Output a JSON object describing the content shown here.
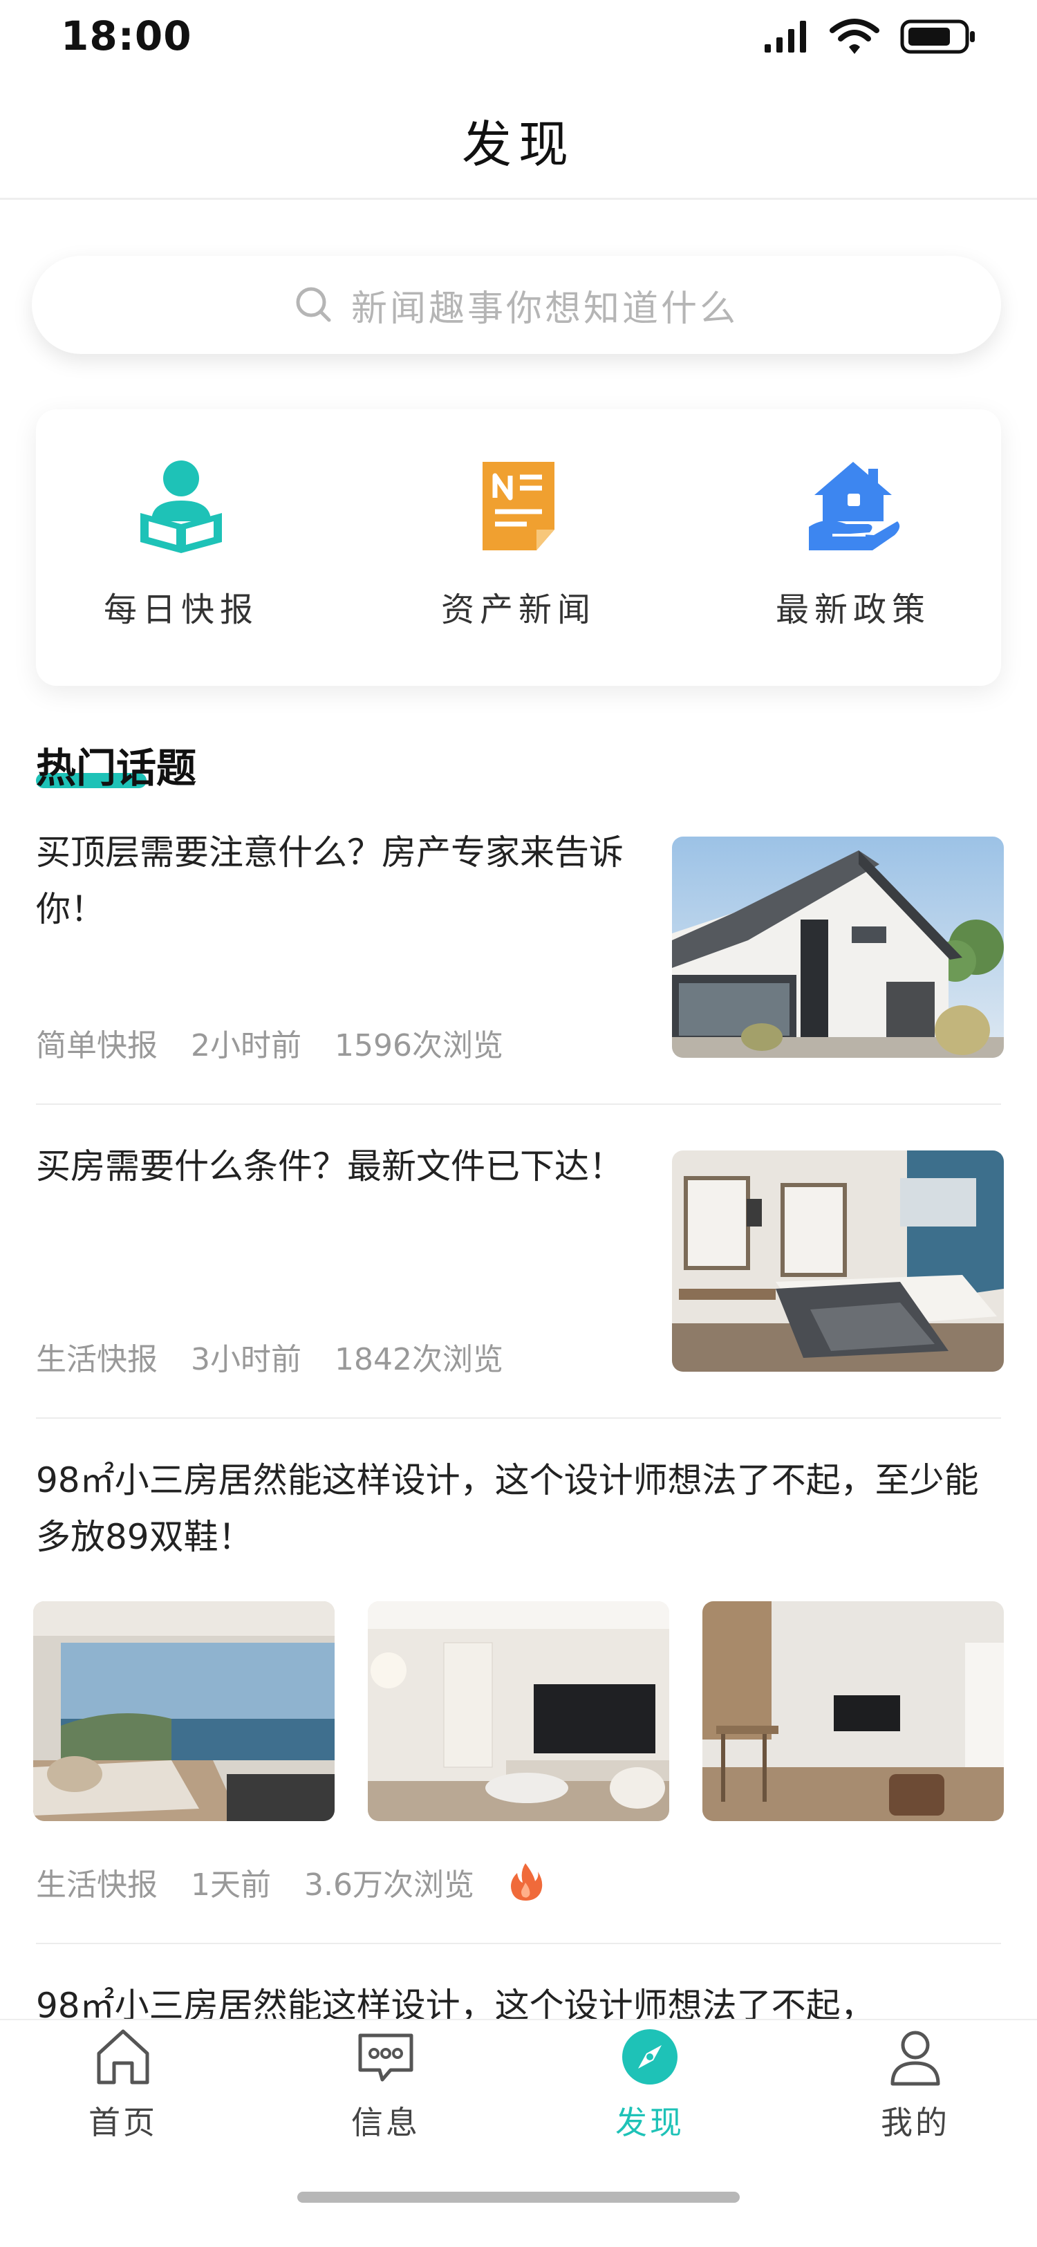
{
  "status_bar": {
    "time": "18:00"
  },
  "header": {
    "title": "发现"
  },
  "search": {
    "placeholder": "新闻趣事你想知道什么"
  },
  "categories": [
    {
      "label": "每日快报",
      "icon": "reader-icon",
      "color": "#1ec2b7"
    },
    {
      "label": "资产新闻",
      "icon": "news-document-icon",
      "color": "#f0a030"
    },
    {
      "label": "最新政策",
      "icon": "house-in-hand-icon",
      "color": "#3d86f0"
    }
  ],
  "hot_topics": {
    "title": "热门话题",
    "articles": [
      {
        "title": "买顶层需要注意什么？房产专家来告诉你！",
        "source": "简单快报",
        "time": "2小时前",
        "views": "1596次浏览",
        "image": "modern-house-exterior-photo"
      },
      {
        "title": "买房需要什么条件？最新文件已下达！",
        "source": "生活快报",
        "time": "3小时前",
        "views": "1842次浏览",
        "image": "bedroom-interior-photo"
      },
      {
        "title": "98㎡小三房居然能这样设计，这个设计师想法了不起，至少能多放89双鞋！",
        "source": "生活快报",
        "time": "1天前",
        "views": "3.6万次浏览",
        "images": [
          "bedroom-ocean-view-photo",
          "living-room-photo",
          "tv-wall-living-room-photo"
        ],
        "hot": true
      },
      {
        "title": "98㎡小三房居然能这样设计，这个设计师想法了不起，"
      }
    ]
  },
  "tabbar": {
    "items": [
      {
        "label": "首页",
        "icon": "home-icon"
      },
      {
        "label": "信息",
        "icon": "message-icon"
      },
      {
        "label": "发现",
        "icon": "compass-icon",
        "active": true
      },
      {
        "label": "我的",
        "icon": "user-icon"
      }
    ]
  },
  "colors": {
    "accent": "#1ec2b7",
    "orange": "#f0a030",
    "blue": "#3d86f0",
    "hot": "#f06a3a"
  }
}
